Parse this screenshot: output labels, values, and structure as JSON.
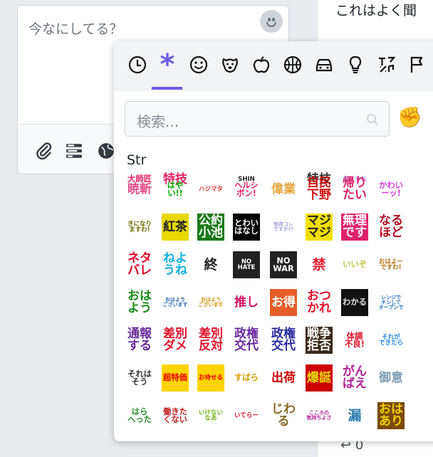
{
  "compose": {
    "placeholder": "今なにしてる？"
  },
  "right_panel": {
    "text": "これはよく聞"
  },
  "bottom": {
    "count": "0"
  },
  "picker": {
    "categories": [
      "recent-icon",
      "custom-icon",
      "smiley-icon",
      "animal-icon",
      "food-icon",
      "activity-icon",
      "travel-icon",
      "objects-icon",
      "symbols-icon",
      "flags-icon"
    ],
    "accent": "#6c5ce7",
    "search_placeholder": "検索...",
    "skin_tone": "✊",
    "section_title": "Str",
    "stamps": [
      [
        "大師匠",
        "特技",
        "",
        "SHIN",
        "",
        "特技",
        "なにそれ",
        "",
        ""
      ],
      [
        "暁斬",
        "はや\nい!!",
        "ハジマタ",
        "ヘルシ\nボン!",
        "偉業",
        "自民\n下野",
        "帰り\nたい",
        "かわい\nーッ!"
      ],
      [
        "きになり\nますわ!",
        "紅茶",
        "公約\n小池",
        "とわい\nはなし",
        "毎夜コレ\nですか!?",
        "マジ\nマジ",
        "無理\nです",
        "なる\nほど"
      ],
      [
        "ネタ\nバレ",
        "ねよ\nうね",
        "終",
        "NO\nHATE",
        "NO\nWAR",
        "禁",
        "いいぞ",
        "おはよー\nですわ!"
      ],
      [
        "おは\nよう",
        "おはよう\nございます",
        "おはよう\nございます",
        "推し",
        "お得",
        "おつ\nかれ",
        "わかる",
        "レンジで\nチンして\nオーブンで"
      ],
      [
        "通報\nする",
        "差別\nダメ",
        "差別\n反対",
        "政権\n交代",
        "政権\n交代",
        "戦争\n拒否",
        "体調\n不良!",
        "それが\nできたら"
      ],
      [
        "それは\nそう",
        "超特価",
        "お待せる",
        "すばら",
        "出荷",
        "爆誕",
        "がん\nばえ",
        "御意"
      ],
      [
        "はら\nへった",
        "働きた\nくない",
        "いけない\nなあ",
        "いてらー",
        "じわ\nる",
        "こころの\n気持ちよさ",
        "漏",
        "おは\nあり"
      ]
    ]
  }
}
